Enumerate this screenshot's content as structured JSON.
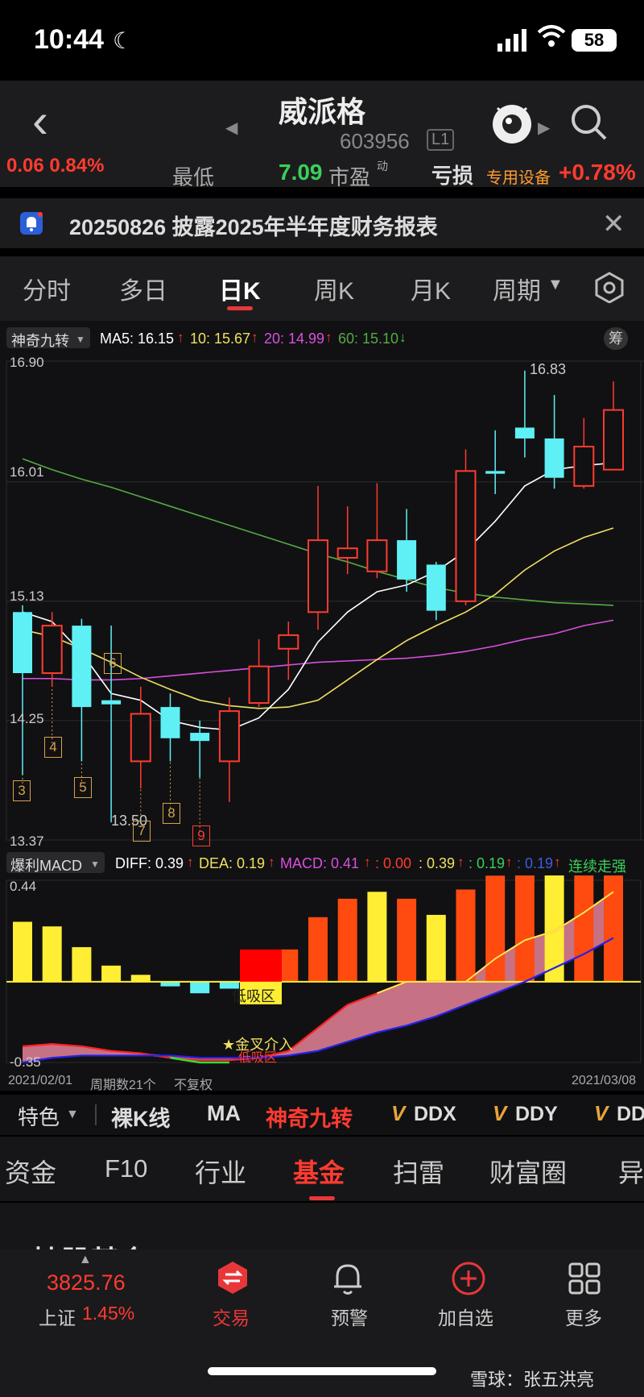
{
  "status_bar": {
    "time": "10:44",
    "battery": "58"
  },
  "header": {
    "title": "威派格",
    "code": "603956",
    "level": "L1"
  },
  "ticker": {
    "left_value": "0.06 0.84%",
    "low_label": "最低",
    "low_value": "7.09",
    "pe_label": "市盈",
    "pe_superscript": "动",
    "pe_value": "亏损",
    "sector": "专用设备",
    "sector_change": "+0.78%"
  },
  "notice": {
    "text": "20250826 披露2025年半年度财务报表"
  },
  "tabs": [
    "分时",
    "多日",
    "日K",
    "周K",
    "月K",
    "周期"
  ],
  "active_tab": 2,
  "indicator_bar": {
    "indicator": "神奇九转",
    "ma5": "MA5: 16.15",
    "ma10": "10: 15.67",
    "ma20": "20: 14.99",
    "ma60": "60: 15.10",
    "chip_button": "筹"
  },
  "price_axis": [
    "16.90",
    "16.01",
    "15.13",
    "14.25",
    "13.37"
  ],
  "annotations": {
    "high": "16.83",
    "low": "13.50"
  },
  "nine_turn_labels": [
    "3",
    "4",
    "5",
    "6",
    "7",
    "8",
    "9"
  ],
  "macd_bar": {
    "indicator": "爆利MACD",
    "diff": "DIFF: 0.39",
    "dea": "DEA: 0.19",
    "macd": "MACD: 0.41",
    "v1": ": 0.00",
    "v2": ": 0.39",
    "v3": ": 0.19",
    "v4": ": 0.19",
    "trend": "连续走强",
    "axis_top": "0.44",
    "axis_bottom": "-0.35",
    "golden_cross": "★金叉介入",
    "low_zone": "低吸区",
    "overlap_text": "低吸区"
  },
  "date_row": {
    "start": "2021/02/01",
    "periods": "周期数21个",
    "adjust": "不复权",
    "end": "2021/03/08"
  },
  "feature_bar": {
    "special": "特色",
    "items": [
      "裸K线",
      "MA",
      "神奇九转",
      "DDX",
      "DDY",
      "DD"
    ]
  },
  "sub_tabs": [
    "资金",
    "F10",
    "行业",
    "基金",
    "扫雷",
    "财富圈",
    "异"
  ],
  "active_sub_tab": 3,
  "peek_text": "持股基金",
  "index": {
    "value": "3825.76",
    "name": "上证",
    "change": "1.45%"
  },
  "bottom_nav": [
    "交易",
    "预警",
    "加自选",
    "更多"
  ],
  "watermark": "雪球：张五洪亮",
  "colors": {
    "up": "#ff3b30",
    "down": "#5ef0f5",
    "ma5": "#ffffff",
    "ma10": "#f0e060",
    "ma20": "#d94fe0",
    "ma60": "#55aa44",
    "accent": "#e8373a"
  },
  "chart_data": {
    "type": "candlestick",
    "ylim": [
      13.37,
      16.9
    ],
    "candles": [
      {
        "o": 15.05,
        "c": 14.6,
        "h": 15.1,
        "l": 13.85
      },
      {
        "o": 14.6,
        "c": 14.95,
        "h": 15.05,
        "l": 14.5
      },
      {
        "o": 14.95,
        "c": 14.35,
        "h": 15.0,
        "l": 13.95
      },
      {
        "o": 14.4,
        "c": 14.37,
        "h": 14.95,
        "l": 13.5
      },
      {
        "o": 13.95,
        "c": 14.3,
        "h": 14.5,
        "l": 13.75
      },
      {
        "o": 14.35,
        "c": 14.12,
        "h": 14.45,
        "l": 13.95
      },
      {
        "o": 14.16,
        "c": 14.1,
        "h": 14.25,
        "l": 13.83
      },
      {
        "o": 13.95,
        "c": 14.32,
        "h": 14.42,
        "l": 13.65
      },
      {
        "o": 14.38,
        "c": 14.65,
        "h": 14.85,
        "l": 14.35
      },
      {
        "o": 14.78,
        "c": 14.88,
        "h": 14.98,
        "l": 14.55
      },
      {
        "o": 15.05,
        "c": 15.58,
        "h": 15.98,
        "l": 14.92
      },
      {
        "o": 15.45,
        "c": 15.52,
        "h": 15.83,
        "l": 15.33
      },
      {
        "o": 15.35,
        "c": 15.58,
        "h": 16.0,
        "l": 15.3
      },
      {
        "o": 15.58,
        "c": 15.29,
        "h": 15.81,
        "l": 15.2
      },
      {
        "o": 15.4,
        "c": 15.06,
        "h": 15.42,
        "l": 14.99
      },
      {
        "o": 15.13,
        "c": 16.09,
        "h": 16.25,
        "l": 15.1
      },
      {
        "o": 16.09,
        "c": 16.07,
        "h": 16.39,
        "l": 15.92
      },
      {
        "o": 16.41,
        "c": 16.33,
        "h": 16.83,
        "l": 16.19
      },
      {
        "o": 16.33,
        "c": 16.04,
        "h": 16.65,
        "l": 15.96
      },
      {
        "o": 15.98,
        "c": 16.27,
        "h": 16.48,
        "l": 15.96
      },
      {
        "o": 16.1,
        "c": 16.54,
        "h": 16.75,
        "l": 16.1
      }
    ],
    "ma5": [
      15.05,
      14.98,
      14.75,
      14.45,
      14.4,
      14.25,
      14.2,
      14.18,
      14.27,
      14.48,
      14.83,
      15.05,
      15.2,
      15.25,
      15.35,
      15.5,
      15.72,
      15.98,
      16.1,
      16.13,
      16.15
    ],
    "ma10": [
      14.92,
      14.87,
      14.78,
      14.68,
      14.57,
      14.48,
      14.4,
      14.36,
      14.34,
      14.35,
      14.4,
      14.55,
      14.7,
      14.84,
      14.95,
      15.05,
      15.18,
      15.36,
      15.5,
      15.6,
      15.67
    ],
    "ma20": [
      14.56,
      14.56,
      14.55,
      14.55,
      14.56,
      14.58,
      14.6,
      14.62,
      14.64,
      14.66,
      14.68,
      14.69,
      14.7,
      14.71,
      14.73,
      14.76,
      14.8,
      14.85,
      14.89,
      14.95,
      14.99
    ],
    "ma60": [
      16.18,
      16.1,
      16.03,
      15.97,
      15.9,
      15.83,
      15.76,
      15.69,
      15.62,
      15.55,
      15.48,
      15.42,
      15.35,
      15.29,
      15.23,
      15.19,
      15.16,
      15.14,
      15.12,
      15.11,
      15.1
    ],
    "macd_hist": [
      0.26,
      0.24,
      0.15,
      0.07,
      0.03,
      -0.02,
      -0.05,
      -0.03,
      0.13,
      0.14,
      0.28,
      0.36,
      0.39,
      0.36,
      0.29,
      0.4,
      0.46,
      0.53,
      0.48,
      0.48,
      0.48
    ],
    "diff": [
      -0.28,
      -0.27,
      -0.28,
      -0.3,
      -0.31,
      -0.33,
      -0.34,
      -0.34,
      -0.33,
      -0.3,
      -0.2,
      -0.1,
      -0.05,
      0.0,
      0.0,
      0.0,
      0.1,
      0.18,
      0.22,
      0.3,
      0.39
    ],
    "dea": [
      -0.35,
      -0.33,
      -0.32,
      -0.32,
      -0.32,
      -0.32,
      -0.33,
      -0.33,
      -0.33,
      -0.32,
      -0.3,
      -0.26,
      -0.22,
      -0.19,
      -0.15,
      -0.1,
      -0.05,
      0.0,
      0.06,
      0.12,
      0.19
    ]
  }
}
